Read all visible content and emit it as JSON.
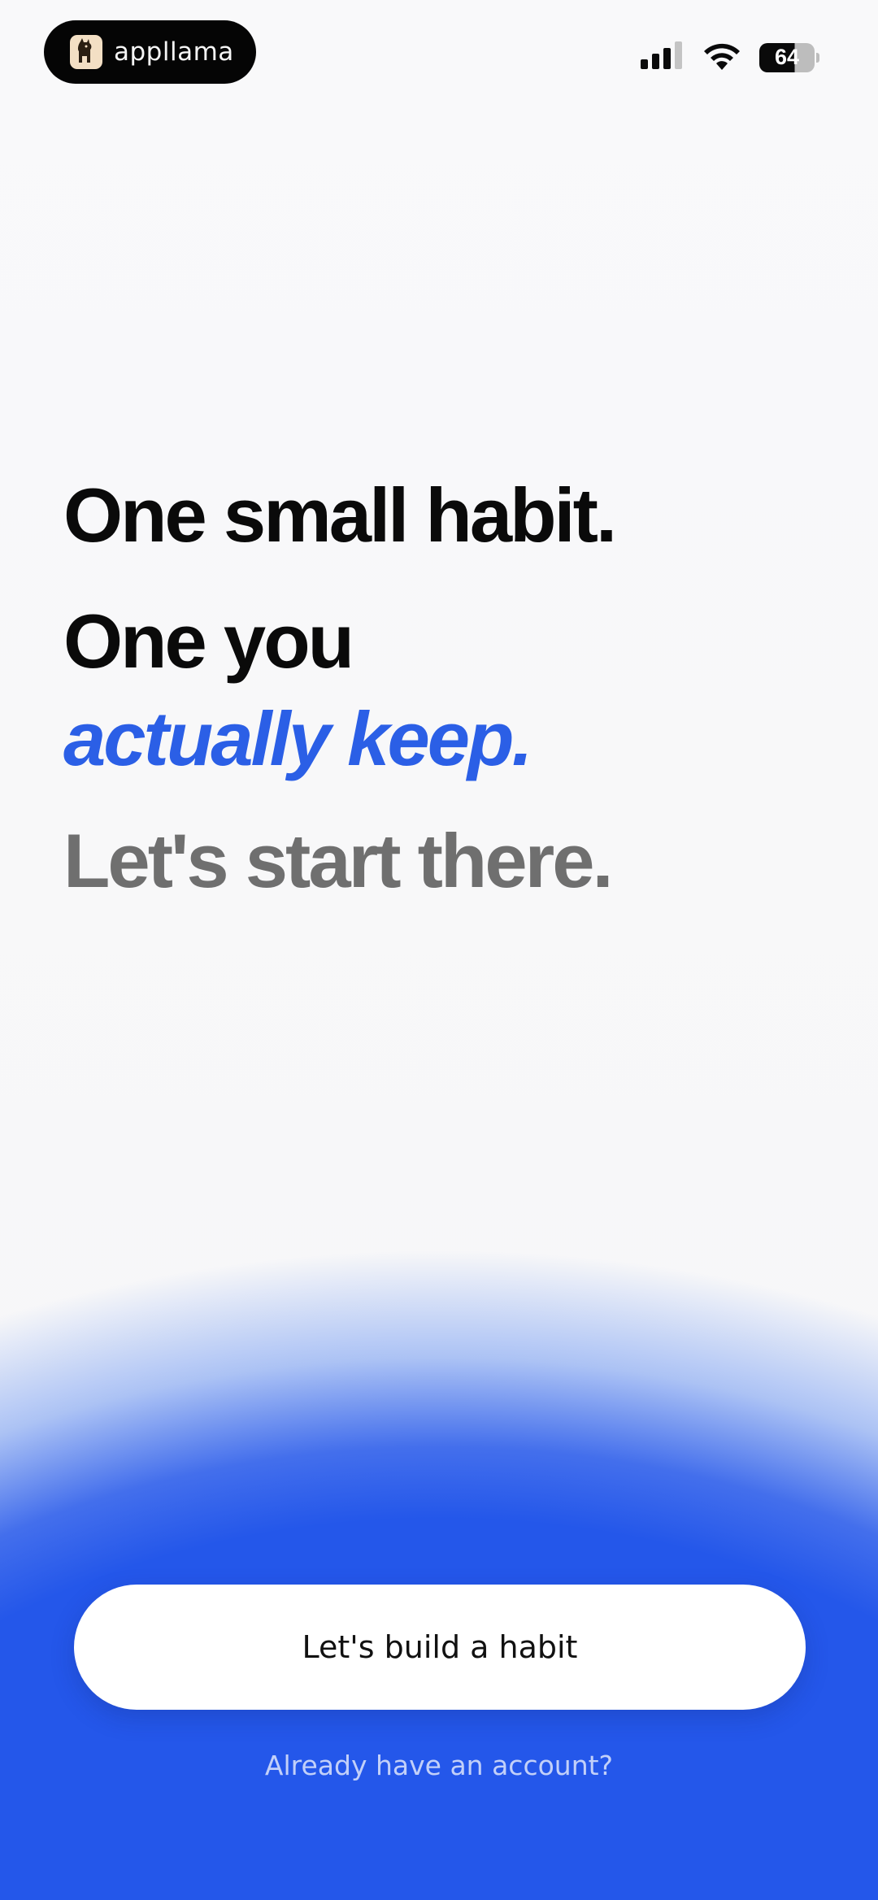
{
  "status_bar": {
    "app_name": "appllama",
    "battery_level": "64",
    "icons": [
      "cellular-signal-icon",
      "wifi-icon",
      "battery-icon"
    ]
  },
  "headline": {
    "line1": "One small habit.",
    "line2": "One you",
    "line3": "actually keep.",
    "line4": "Let's start there."
  },
  "actions": {
    "primary_label": "Let's build a habit",
    "secondary_label": "Already have an account?"
  },
  "colors": {
    "accent": "#2457ea",
    "headline_accent": "#2b5fe6",
    "muted_text": "#6f6f6f"
  }
}
